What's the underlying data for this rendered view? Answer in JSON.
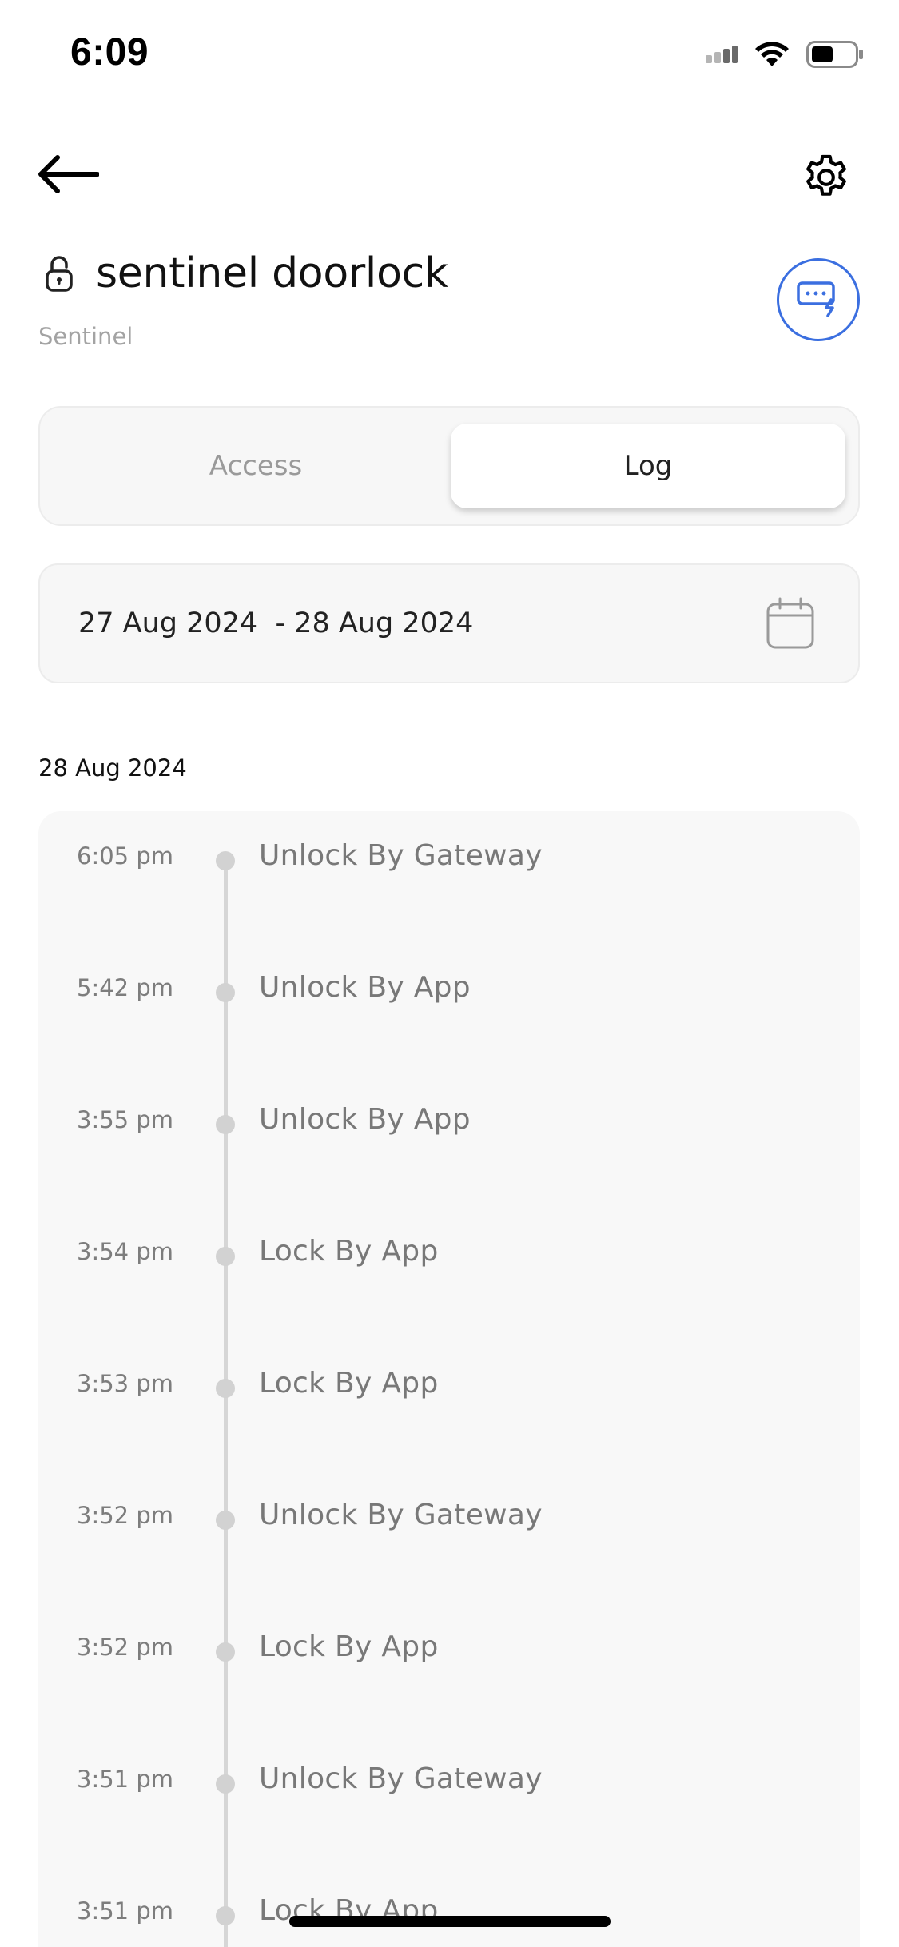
{
  "status_bar": {
    "time": "6:09"
  },
  "header": {
    "device_name": "sentinel doorlock",
    "brand": "Sentinel"
  },
  "tabs": [
    {
      "label": "Access",
      "selected": false
    },
    {
      "label": "Log",
      "selected": true
    }
  ],
  "date_range": {
    "text": "27 Aug 2024  - 28 Aug 2024"
  },
  "log": {
    "section_date": "28 Aug 2024",
    "entries": [
      {
        "time": "6:05 pm",
        "event": "Unlock By Gateway"
      },
      {
        "time": "5:42 pm",
        "event": "Unlock By App"
      },
      {
        "time": "3:55 pm",
        "event": "Unlock By App"
      },
      {
        "time": "3:54 pm",
        "event": "Lock By App"
      },
      {
        "time": "3:53 pm",
        "event": "Lock By App"
      },
      {
        "time": "3:52 pm",
        "event": "Unlock By Gateway"
      },
      {
        "time": "3:52 pm",
        "event": "Lock By App"
      },
      {
        "time": "3:51 pm",
        "event": "Unlock By Gateway"
      },
      {
        "time": "3:51 pm",
        "event": "Lock By App"
      }
    ]
  },
  "colors": {
    "accent": "#3b6fe0",
    "timeline": "#d6d6d6",
    "panel_bg": "#f8f8f8"
  },
  "icons": {
    "back": "arrow-left-icon",
    "settings": "gear-icon",
    "lock": "lock-icon",
    "quick_action": "keypad-flash-icon",
    "calendar": "calendar-icon"
  }
}
